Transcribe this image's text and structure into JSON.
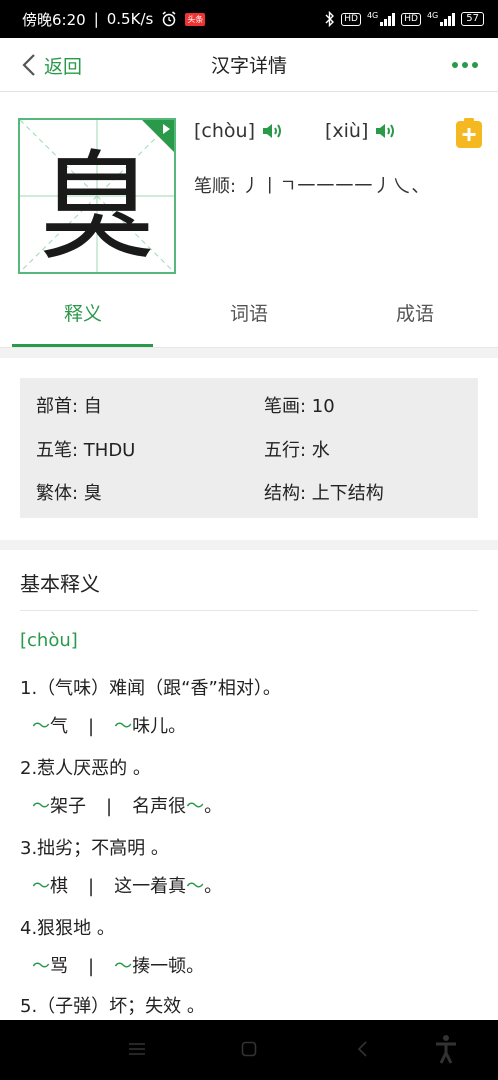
{
  "status_bar": {
    "time": "傍晚6:20",
    "speed": "0.5K/s",
    "toutiao_label": "头条",
    "battery": "57",
    "hd_label": "HD",
    "net_label": "4G"
  },
  "nav": {
    "back_label": "返回",
    "title": "汉字详情"
  },
  "character": {
    "glyph": "臭",
    "pronunciations": [
      {
        "pinyin": "[chòu]"
      },
      {
        "pinyin": "[xiù]"
      }
    ],
    "stroke_label": "笔顺:",
    "strokes": "丿丨ㄱ一一一一丿乀、"
  },
  "tabs": [
    {
      "label": "释义",
      "active": true
    },
    {
      "label": "词语",
      "active": false
    },
    {
      "label": "成语",
      "active": false
    }
  ],
  "info": {
    "radical": "部首: 自",
    "stroke_count": "笔画: 10",
    "wubi": "五笔: THDU",
    "wuxing": "五行: 水",
    "traditional": "繁体: 臭",
    "structure": "结构: 上下结构"
  },
  "definitions": {
    "title": "基本释义",
    "pinyin": "[chòu]",
    "items": [
      {
        "text": "1.（气味）难闻（跟“香”相对）。",
        "ex1_pre": "",
        "ex1_post": "气",
        "ex2_pre": "",
        "ex2_post": "味儿。"
      },
      {
        "text": "2.惹人厌恶的 。",
        "ex1_pre": "",
        "ex1_post": "架子",
        "ex2_pre": "名声很",
        "ex2_post": "。"
      },
      {
        "text": "3.拙劣；不高明 。",
        "ex1_pre": "",
        "ex1_post": "棋",
        "ex2_pre": "这一着真",
        "ex2_post": "。"
      },
      {
        "text": "4.狠狠地 。",
        "ex1_pre": "",
        "ex1_post": "骂",
        "ex2_pre": "",
        "ex2_post": "揍一顿。"
      },
      {
        "text": "5.（子弹）坏；失效 。"
      }
    ],
    "tilde": "～",
    "separator": "|"
  },
  "colors": {
    "accent": "#2a9a4a",
    "add_button": "#f5b820"
  }
}
